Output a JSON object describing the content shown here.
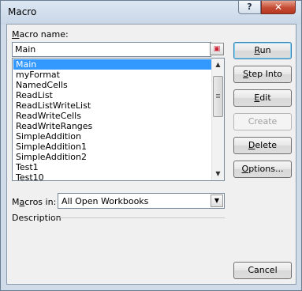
{
  "window": {
    "title": "Macro",
    "help_label": "?",
    "close_label": "✕"
  },
  "macro_name": {
    "label": "Macro name:",
    "value": "Main"
  },
  "macros": {
    "items": [
      "Main",
      "myFormat",
      "NamedCells",
      "ReadList",
      "ReadListWriteList",
      "ReadWriteCells",
      "ReadWriteRanges",
      "SimpleAddition",
      "SimpleAddition1",
      "SimpleAddition2",
      "Test1",
      "Test10"
    ],
    "selected": "Main"
  },
  "macros_in": {
    "label": "Macros in:",
    "value": "All Open Workbooks"
  },
  "description": {
    "label": "Description"
  },
  "buttons": {
    "run": "Run",
    "step_into": "Step Into",
    "edit": "Edit",
    "create": "Create",
    "delete": "Delete",
    "options": "Options...",
    "cancel": "Cancel"
  },
  "icons": {
    "help": "help-icon",
    "close": "close-icon",
    "ref": "collapse-dialog-icon",
    "dropdown": "chevron-down-icon"
  }
}
